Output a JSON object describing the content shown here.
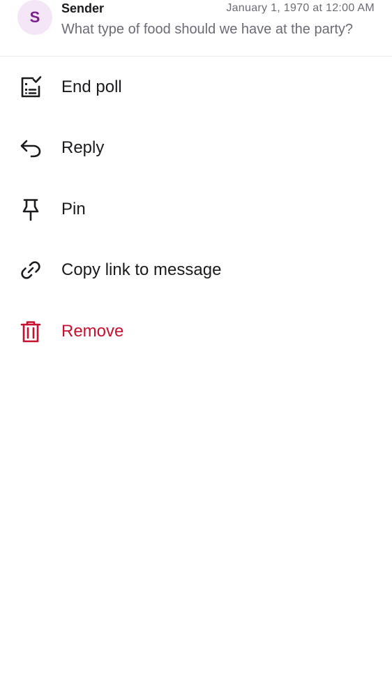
{
  "header": {
    "avatar_initial": "S",
    "sender": "Sender",
    "timestamp": "January 1, 1970 at 12:00 AM",
    "message_preview": "What type of food should we have at the party?"
  },
  "menu": {
    "items": [
      {
        "label": "End poll",
        "icon": "poll-end-icon"
      },
      {
        "label": "Reply",
        "icon": "reply-icon"
      },
      {
        "label": "Pin",
        "icon": "pin-icon"
      },
      {
        "label": "Copy link to message",
        "icon": "link-icon"
      },
      {
        "label": "Remove",
        "icon": "trash-icon"
      }
    ]
  },
  "colors": {
    "text_primary": "#1b1b1f",
    "text_secondary": "#6b6b75",
    "danger": "#c8102e",
    "avatar_bg": "#f5e6f7",
    "avatar_fg": "#7b1f8f"
  }
}
